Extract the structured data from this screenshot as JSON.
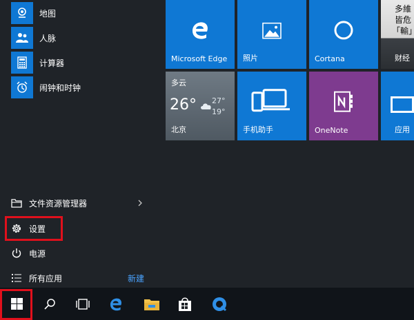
{
  "apps": [
    {
      "label": "地图",
      "icon": "map-pin-icon"
    },
    {
      "label": "人脉",
      "icon": "people-icon"
    },
    {
      "label": "计算器",
      "icon": "calculator-icon"
    },
    {
      "label": "闹钟和时钟",
      "icon": "alarm-clock-icon"
    }
  ],
  "system": {
    "explorer": "文件资源管理器",
    "settings": "设置",
    "power": "电源",
    "all_apps": "所有应用",
    "new_badge": "新建"
  },
  "tiles": {
    "edge": "Microsoft Edge",
    "photos": "照片",
    "cortana": "Cortana",
    "weather": {
      "condition": "多云",
      "temp": "26°",
      "high": "27°",
      "low": "19°",
      "city": "北京"
    },
    "phone_companion": "手机助手",
    "onenote": "OneNote",
    "finance_label": "财经",
    "finance_text1": "多維",
    "finance_text2": "皆危",
    "finance_text3": "「輸」",
    "apps_tile": "应用"
  },
  "colors": {
    "tile_blue": "#0f78d4",
    "onenote_purple": "#7e3b8f",
    "highlight_red": "#e0101c",
    "new_link_blue": "#4aa3ff"
  }
}
